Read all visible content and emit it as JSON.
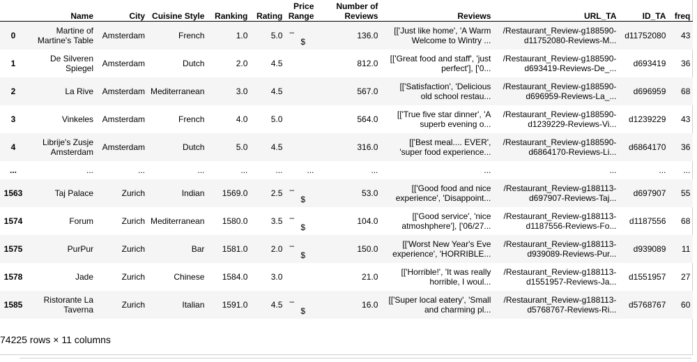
{
  "columns": {
    "index": "",
    "name": "Name",
    "city": "City",
    "cuisine": "Cuisine Style",
    "ranking": "Ranking",
    "rating": "Rating",
    "price_line1": "Price",
    "price_line2": "Range",
    "nrev_line1": "Number of",
    "nrev_line2": "Reviews",
    "reviews": "Reviews",
    "url": "URL_TA",
    "id": "ID_TA",
    "freq": "freq"
  },
  "rows": [
    {
      "idx": "0",
      "name_l1": "Martine of",
      "name_l2": "Martine's Table",
      "city": "Amsterdam",
      "cuisine": "French",
      "ranking": "1.0",
      "rating": "5.0",
      "price_dash": "–",
      "price_dollar": "$",
      "nrev": "136.0",
      "rev_l1": "[['Just like home', 'A Warm",
      "rev_l2": "Welcome to Wintry ...",
      "url_l1": "/Restaurant_Review-g188590-",
      "url_l2": "d11752080-Reviews-M...",
      "id": "d11752080",
      "freq": "43"
    },
    {
      "idx": "1",
      "name_l1": "De Silveren",
      "name_l2": "Spiegel",
      "city": "Amsterdam",
      "cuisine": "Dutch",
      "ranking": "2.0",
      "rating": "4.5",
      "price_dash": "",
      "price_dollar": "",
      "nrev": "812.0",
      "rev_l1": "[['Great food and staff', 'just",
      "rev_l2": "perfect'], ['0...",
      "url_l1": "/Restaurant_Review-g188590-",
      "url_l2": "d693419-Reviews-De_...",
      "id": "d693419",
      "freq": "36"
    },
    {
      "idx": "2",
      "name_l1": "La Rive",
      "name_l2": "",
      "city": "Amsterdam",
      "cuisine": "Mediterranean",
      "ranking": "3.0",
      "rating": "4.5",
      "price_dash": "",
      "price_dollar": "",
      "nrev": "567.0",
      "rev_l1": "[['Satisfaction', 'Delicious",
      "rev_l2": "old school restau...",
      "url_l1": "/Restaurant_Review-g188590-",
      "url_l2": "d696959-Reviews-La_...",
      "id": "d696959",
      "freq": "68"
    },
    {
      "idx": "3",
      "name_l1": "Vinkeles",
      "name_l2": "",
      "city": "Amsterdam",
      "cuisine": "French",
      "ranking": "4.0",
      "rating": "5.0",
      "price_dash": "",
      "price_dollar": "",
      "nrev": "564.0",
      "rev_l1": "[['True five star dinner', 'A",
      "rev_l2": "superb evening o...",
      "url_l1": "/Restaurant_Review-g188590-",
      "url_l2": "d1239229-Reviews-Vi...",
      "id": "d1239229",
      "freq": "43"
    },
    {
      "idx": "4",
      "name_l1": "Librije's Zusje",
      "name_l2": "Amsterdam",
      "city": "Amsterdam",
      "cuisine": "Dutch",
      "ranking": "5.0",
      "rating": "4.5",
      "price_dash": "",
      "price_dollar": "",
      "nrev": "316.0",
      "rev_l1": "[['Best meal.... EVER',",
      "rev_l2": "'super food experience...",
      "url_l1": "/Restaurant_Review-g188590-",
      "url_l2": "d6864170-Reviews-Li...",
      "id": "d6864170",
      "freq": "36"
    },
    {
      "ellipsis": true,
      "idx": "...",
      "name_l1": "...",
      "name_l2": "",
      "city": "...",
      "cuisine": "...",
      "ranking": "...",
      "rating": "...",
      "price_dash": "...",
      "price_dollar": "",
      "nrev": "...",
      "rev_l1": "...",
      "rev_l2": "",
      "url_l1": "...",
      "url_l2": "",
      "id": "...",
      "freq": "..."
    },
    {
      "idx": "1563",
      "name_l1": "Taj Palace",
      "name_l2": "",
      "city": "Zurich",
      "cuisine": "Indian",
      "ranking": "1569.0",
      "rating": "2.5",
      "price_dash": "–",
      "price_dollar": "$",
      "nrev": "53.0",
      "rev_l1": "[['Good food and nice",
      "rev_l2": "experience', 'Disappoint...",
      "url_l1": "/Restaurant_Review-g188113-",
      "url_l2": "d697907-Reviews-Taj...",
      "id": "d697907",
      "freq": "55"
    },
    {
      "idx": "1574",
      "name_l1": "Forum",
      "name_l2": "",
      "city": "Zurich",
      "cuisine": "Mediterranean",
      "ranking": "1580.0",
      "rating": "3.5",
      "price_dash": "–",
      "price_dollar": "$",
      "nrev": "104.0",
      "rev_l1": "[['Good service', 'nice",
      "rev_l2": "atmoshphere'], ['06/27...",
      "url_l1": "/Restaurant_Review-g188113-",
      "url_l2": "d1187556-Reviews-Fo...",
      "id": "d1187556",
      "freq": "68"
    },
    {
      "idx": "1575",
      "name_l1": "PurPur",
      "name_l2": "",
      "city": "Zurich",
      "cuisine": "Bar",
      "ranking": "1581.0",
      "rating": "2.0",
      "price_dash": "–",
      "price_dollar": "$",
      "nrev": "150.0",
      "rev_l1": "[['Worst New Year's Eve",
      "rev_l2": "experience', 'HORRIBLE...",
      "url_l1": "/Restaurant_Review-g188113-",
      "url_l2": "d939089-Reviews-Pur...",
      "id": "d939089",
      "freq": "11"
    },
    {
      "idx": "1578",
      "name_l1": "Jade",
      "name_l2": "",
      "city": "Zurich",
      "cuisine": "Chinese",
      "ranking": "1584.0",
      "rating": "3.0",
      "price_dash": "",
      "price_dollar": "",
      "nrev": "21.0",
      "rev_l1": "[['Horrible!', 'It was really",
      "rev_l2": "horrible, I woul...",
      "url_l1": "/Restaurant_Review-g188113-",
      "url_l2": "d1551957-Reviews-Ja...",
      "id": "d1551957",
      "freq": "27"
    },
    {
      "idx": "1585",
      "name_l1": "Ristorante La",
      "name_l2": "Taverna",
      "city": "Zurich",
      "cuisine": "Italian",
      "ranking": "1591.0",
      "rating": "4.5",
      "price_dash": "–",
      "price_dollar": "$",
      "nrev": "16.0",
      "rev_l1": "[['Super local eatery', 'Small",
      "rev_l2": "and charming pl...",
      "url_l1": "/Restaurant_Review-g188113-",
      "url_l2": "d5768767-Reviews-Ri...",
      "id": "d5768767",
      "freq": "60"
    }
  ],
  "footer": "74225 rows × 11 columns"
}
